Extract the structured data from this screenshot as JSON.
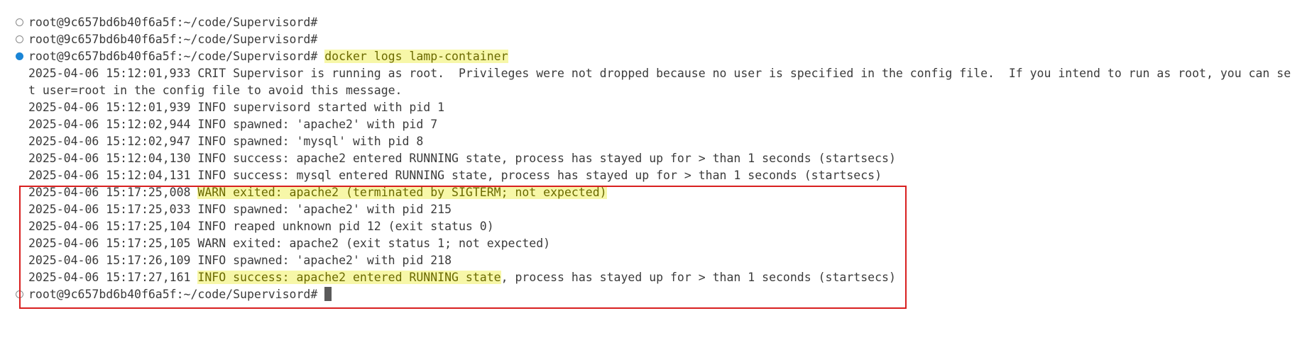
{
  "terminal": {
    "prompt": "root@9c657bd6b40f6a5f:~/code/Supervisord#",
    "command": "docker logs lamp-container",
    "log": [
      {
        "ts": "2025-04-06 15:12:01,933",
        "level_msg": "CRIT Supervisor is running as root.  Privileges were not dropped because no user is specified in the config file.  If you intend to run as root, you can se"
      },
      {
        "wrap": "t user=root in the config file to avoid this message."
      },
      {
        "ts": "2025-04-06 15:12:01,939",
        "level_msg": "INFO supervisord started with pid 1"
      },
      {
        "ts": "2025-04-06 15:12:02,944",
        "level_msg": "INFO spawned: 'apache2' with pid 7"
      },
      {
        "ts": "2025-04-06 15:12:02,947",
        "level_msg": "INFO spawned: 'mysql' with pid 8"
      },
      {
        "ts": "2025-04-06 15:12:04,130",
        "level_msg": "INFO success: apache2 entered RUNNING state, process has stayed up for > than 1 seconds (startsecs)"
      },
      {
        "ts": "2025-04-06 15:12:04,131",
        "level_msg": "INFO success: mysql entered RUNNING state, process has stayed up for > than 1 seconds (startsecs)"
      },
      {
        "ts": "2025-04-06 15:17:25,008",
        "level_msg": "WARN exited: apache2 (terminated by SIGTERM; not expected)"
      },
      {
        "ts": "2025-04-06 15:17:25,033",
        "level_msg": "INFO spawned: 'apache2' with pid 215"
      },
      {
        "ts": "2025-04-06 15:17:25,104",
        "level_msg": "INFO reaped unknown pid 12 (exit status 0)"
      },
      {
        "ts": "2025-04-06 15:17:25,105",
        "level_msg": "WARN exited: apache2 (exit status 1; not expected)"
      },
      {
        "ts": "2025-04-06 15:17:26,109",
        "level_msg": "INFO spawned: 'apache2' with pid 218"
      },
      {
        "ts": "2025-04-06 15:17:27,161",
        "hl_part": "INFO success: apache2 entered RUNNING state",
        "rest": ", process has stayed up for > than 1 seconds (startsecs)"
      }
    ]
  },
  "colors": {
    "highlight_bg": "#f7f7a8",
    "annotation_border": "#d81f1f",
    "active_marker": "#1a85d6"
  }
}
